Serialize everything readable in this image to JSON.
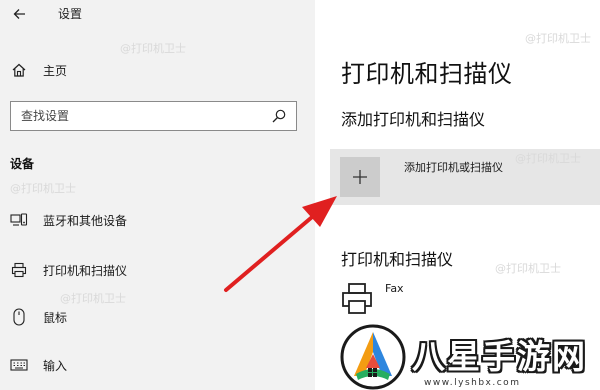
{
  "window": {
    "title": "设置"
  },
  "sidebar": {
    "home_label": "主页",
    "search_placeholder": "查找设置",
    "section_heading": "设备",
    "items": [
      {
        "label": "蓝牙和其他设备",
        "icon": "bluetooth-devices-icon"
      },
      {
        "label": "打印机和扫描仪",
        "icon": "printer-icon"
      },
      {
        "label": "鼠标",
        "icon": "mouse-icon"
      },
      {
        "label": "输入",
        "icon": "keyboard-icon"
      }
    ]
  },
  "main": {
    "page_title": "打印机和扫描仪",
    "add_section_heading": "添加打印机和扫描仪",
    "add_button_label": "添加打印机或扫描仪",
    "list_heading": "打印机和扫描仪",
    "printers": [
      {
        "name": "Fax",
        "icon": "printer-icon"
      }
    ]
  },
  "watermark": {
    "text": "@打印机卫士"
  },
  "logo": {
    "name": "八星手游网",
    "url": "www.lyshbx.com"
  },
  "colors": {
    "arrow": "#e02020",
    "sidebar_bg": "#f2f2f2",
    "add_tile_bg": "#cccccc"
  }
}
